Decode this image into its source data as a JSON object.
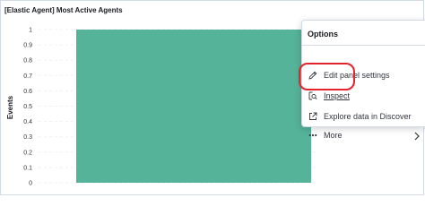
{
  "panel": {
    "title": "[Elastic Agent] Most Active Agents"
  },
  "chart_data": {
    "type": "bar",
    "categories": [
      ""
    ],
    "values": [
      1
    ],
    "ylabel": "Events",
    "xlabel": "",
    "ylim": [
      0,
      1
    ],
    "y_ticks": [
      "1",
      "0.9",
      "0.8",
      "0.7",
      "0.6",
      "0.5",
      "0.4",
      "0.3",
      "0.2",
      "0.1",
      "0"
    ],
    "bar_color": "#54b399",
    "grid": true
  },
  "options_menu": {
    "title": "Options",
    "items": [
      {
        "label": "Edit panel settings",
        "icon": "pencil-icon"
      },
      {
        "label": "Inspect",
        "icon": "inspect-icon"
      },
      {
        "label": "Explore data in Discover",
        "icon": "external-link-icon"
      },
      {
        "label": "More",
        "icon": "more-dots-icon"
      }
    ]
  },
  "colors": {
    "highlight": "#e3242b",
    "bar": "#54b399"
  }
}
